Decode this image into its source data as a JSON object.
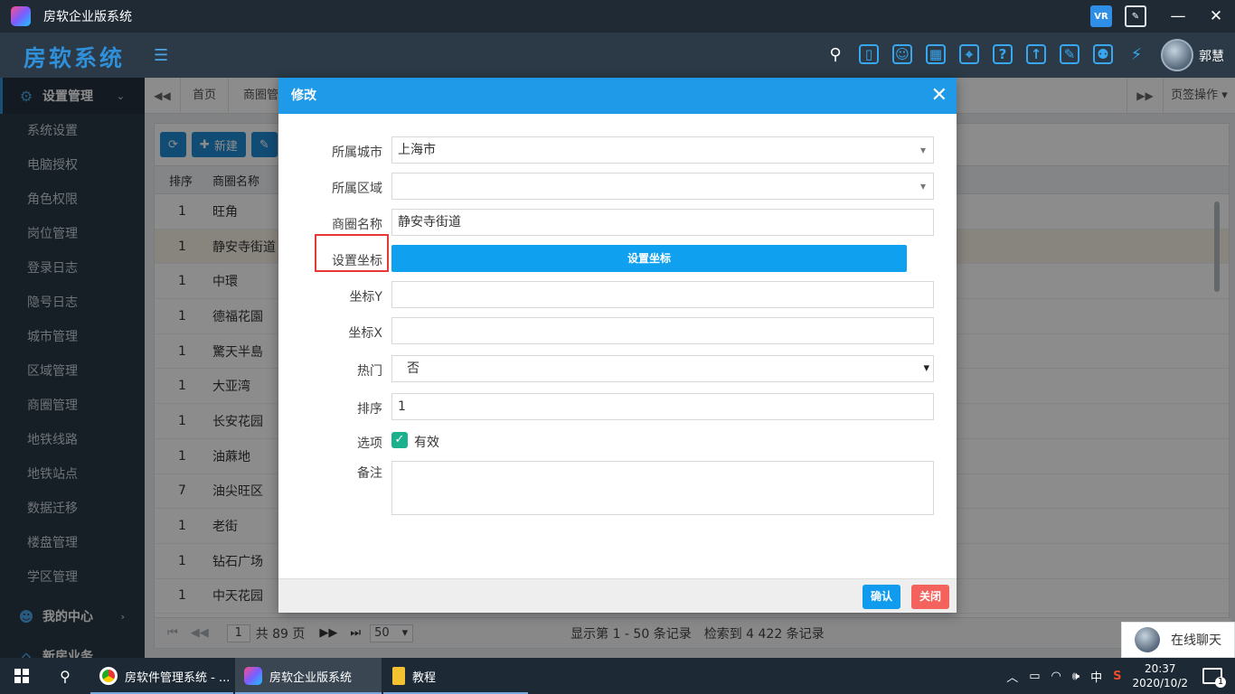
{
  "window": {
    "title": "房软企业版系统",
    "minimize_icon": "minimize-icon",
    "maximize_icon": "maximize-icon",
    "close_icon": "close-icon"
  },
  "header": {
    "brand": "房软系统",
    "user_name": "郭慧",
    "icons": [
      "search-icon",
      "mobile-icon",
      "contacts-icon",
      "apps-icon",
      "location-icon",
      "help-icon",
      "upload-icon",
      "edit-icon",
      "user-location-icon",
      "run-icon"
    ]
  },
  "sidebar": {
    "group_settings": "设置管理",
    "items": [
      "系统设置",
      "电脑授权",
      "角色权限",
      "岗位管理",
      "登录日志",
      "隐号日志",
      "城市管理",
      "区域管理",
      "商圈管理",
      "地铁线路",
      "地铁站点",
      "数据迁移",
      "楼盘管理",
      "学区管理"
    ],
    "group_center": "我的中心",
    "group_newhouse": "新房业务"
  },
  "tabs": {
    "home": "首页",
    "current": "商圈管理",
    "ops": "页签操作"
  },
  "toolbar": {
    "new_label": "新建"
  },
  "grid": {
    "headers": [
      "排序",
      "商圈名称"
    ],
    "rows": [
      {
        "sort": "1",
        "name": "旺角"
      },
      {
        "sort": "1",
        "name": "静安寺街道"
      },
      {
        "sort": "1",
        "name": "中環"
      },
      {
        "sort": "1",
        "name": "德福花園"
      },
      {
        "sort": "1",
        "name": "驚天半島"
      },
      {
        "sort": "1",
        "name": "大亚湾"
      },
      {
        "sort": "1",
        "name": "长安花园"
      },
      {
        "sort": "1",
        "name": "油蔴地"
      },
      {
        "sort": "7",
        "name": "油尖旺区"
      },
      {
        "sort": "1",
        "name": "老街"
      },
      {
        "sort": "1",
        "name": "钻石广场"
      },
      {
        "sort": "1",
        "name": "中天花园"
      }
    ]
  },
  "pager": {
    "page": "1",
    "total_pages": "共 89 页",
    "page_size": "50",
    "showing": "显示第 1 - 50 条记录",
    "found": "检索到 4 422 条记录"
  },
  "chat": {
    "label": "在线聊天"
  },
  "modal": {
    "title": "修改",
    "fields": {
      "city_label": "所属城市",
      "city_value": "上海市",
      "district_label": "所属区域",
      "district_value": "",
      "area_label": "商圈名称",
      "area_value": "静安寺街道",
      "coord_label": "设置坐标",
      "coord_button": "设置坐标",
      "y_label": "坐标Y",
      "y_value": "",
      "x_label": "坐标X",
      "x_value": "",
      "hot_label": "热门",
      "hot_value": "否",
      "sort_label": "排序",
      "sort_value": "1",
      "option_label": "选项",
      "valid_label": "有效",
      "valid_checked": true,
      "note_label": "备注",
      "note_value": ""
    },
    "confirm": "确认",
    "close": "关闭"
  },
  "taskbar": {
    "items": [
      {
        "label": "房软件管理系统 - ..."
      },
      {
        "label": "房软企业版系统"
      },
      {
        "label": "教程"
      }
    ],
    "ime": "中",
    "time": "20:37",
    "date": "2020/10/2",
    "notifications": "1"
  }
}
